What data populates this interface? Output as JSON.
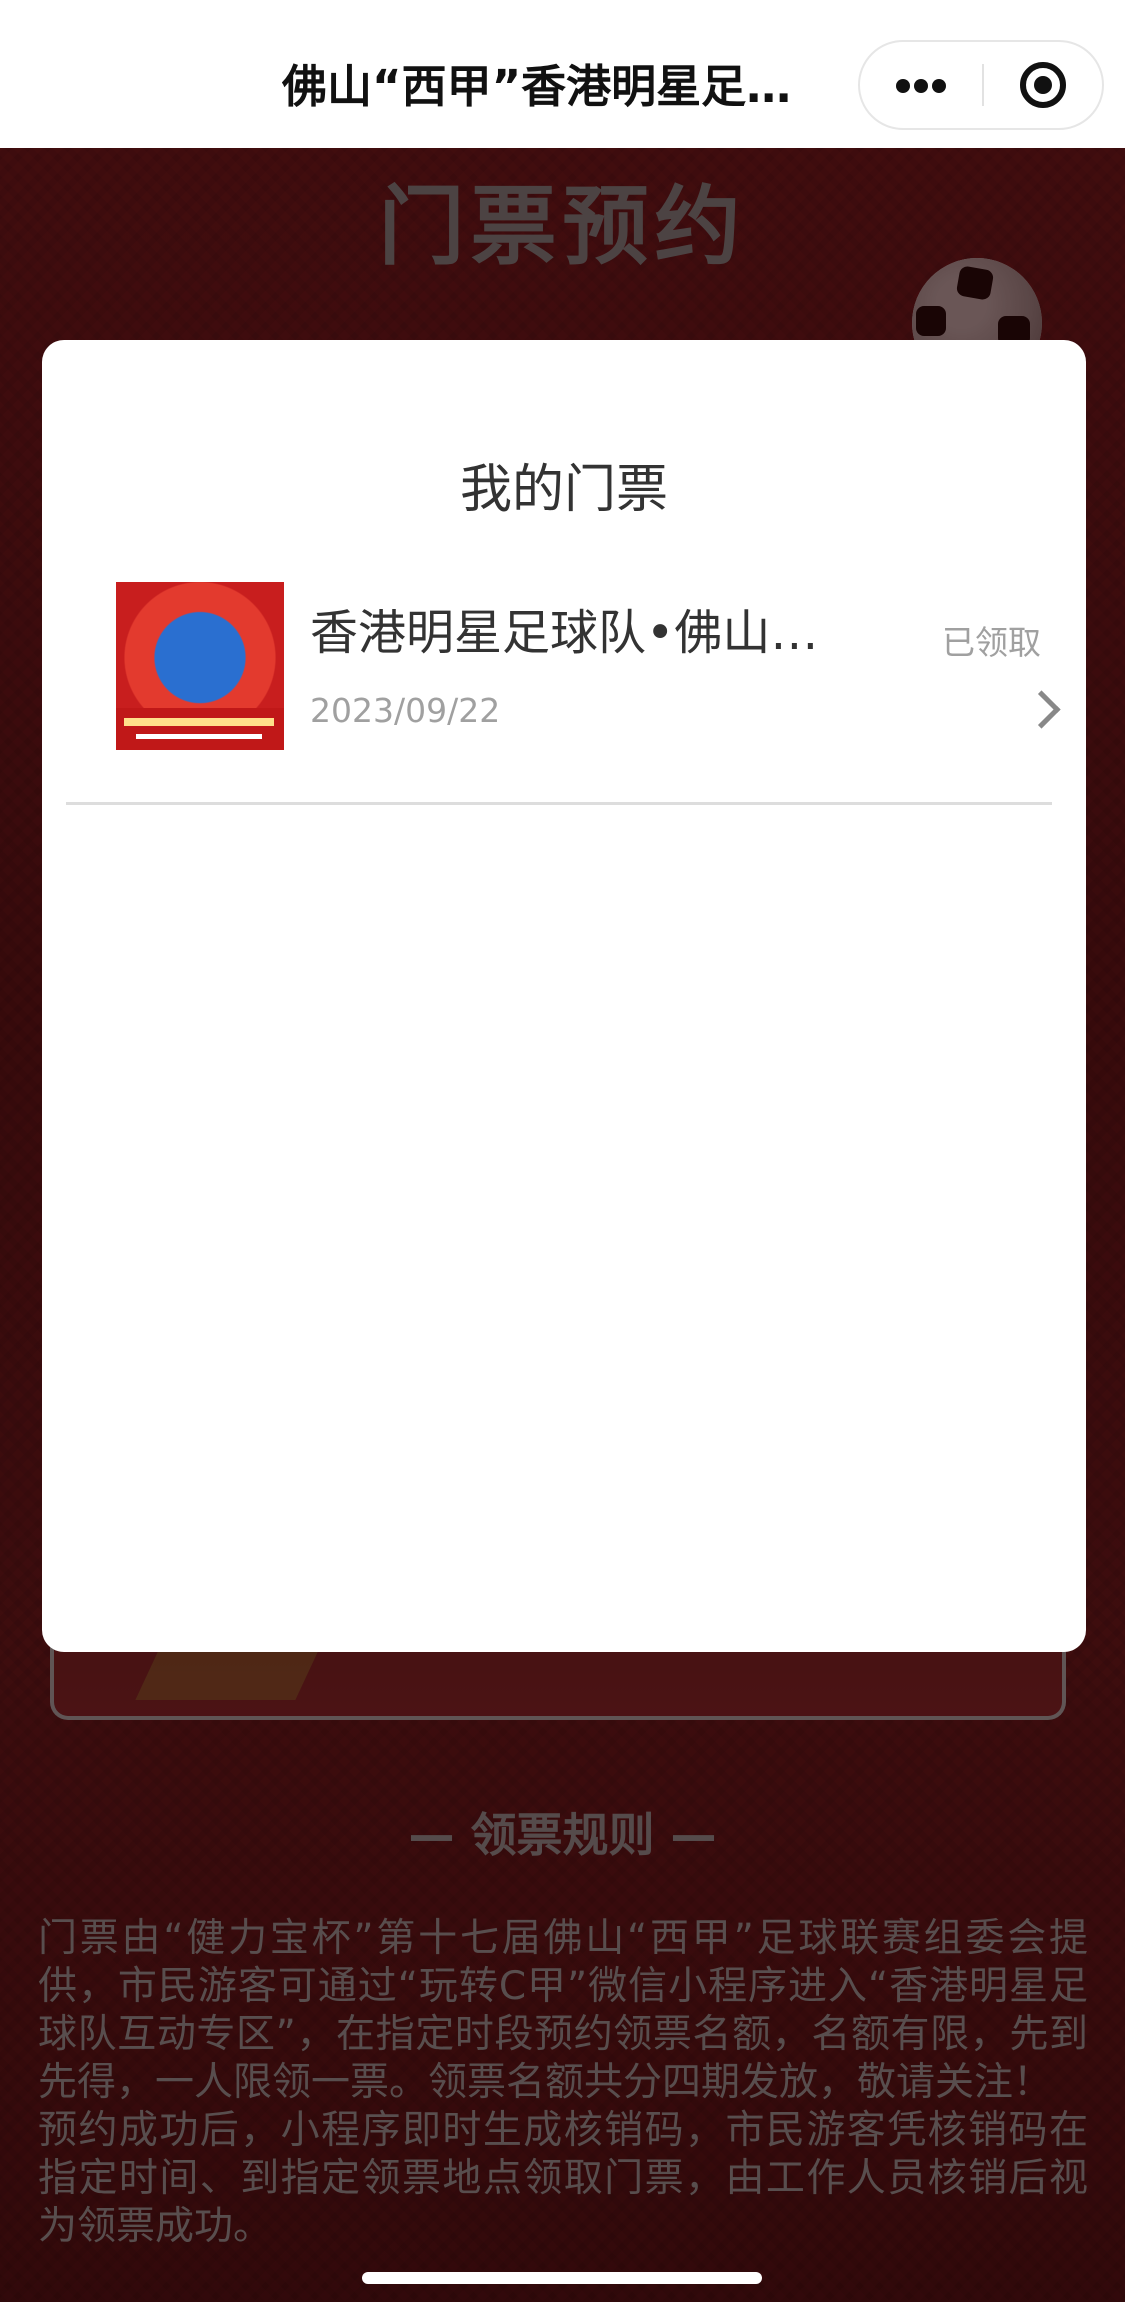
{
  "header": {
    "title": "佛山“西甲”香港明星足…",
    "more_icon": "more-dots-icon",
    "close_icon": "mini-program-close-icon"
  },
  "page": {
    "heading": "门票预约",
    "rules_title": "— 领票规则 —",
    "rules_text": "门票由“健力宝杯”第十七届佛山“西甲”足球联赛组委会提供，市民游客可通过“玩转C甲”微信小程序进入“香港明星足球队互动专区”，在指定时段预约领票名额，名额有限，先到先得，一人限领一票。领票名额共分四期发放，敬请关注！\n预约成功后，小程序即时生成核销码，市民游客凭核销码在指定时间、到指定领票地点领取门票，由工作人员核销后视为领票成功。"
  },
  "modal": {
    "title": "我的门票",
    "tickets": [
      {
        "name": "香港明星足球队•佛山…",
        "date": "2023/09/22",
        "status": "已领取"
      }
    ]
  },
  "colors": {
    "background": "#5e1416",
    "modal": "#ffffff",
    "muted_text": "#a0a0a0"
  }
}
